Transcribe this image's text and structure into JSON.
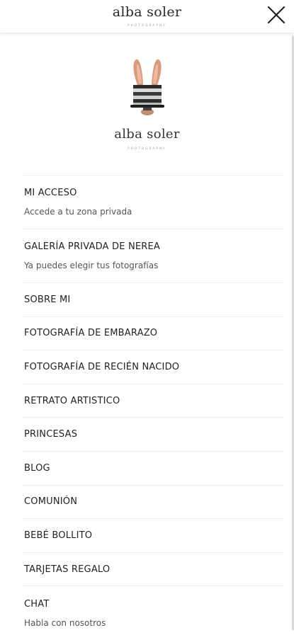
{
  "header": {
    "brand_name": "alba soler",
    "brand_tagline": "PHOTOGRAPHY",
    "close_icon": "close-icon"
  },
  "logo": {
    "brand_name": "alba soler",
    "brand_tagline": "PHOTOGRAPHY",
    "illustration": "bunny-ears-hat-illustration"
  },
  "menu": {
    "items": [
      {
        "label": "MI ACCESO",
        "sub": "Accede a tu zona privada"
      },
      {
        "label": "GALERÍA PRIVADA DE NEREA",
        "sub": "Ya puedes elegir tus fotografías"
      },
      {
        "label": "SOBRE MI"
      },
      {
        "label": "FOTOGRAFÍA DE EMBARAZO"
      },
      {
        "label": "FOTOGRAFÍA DE RECIÉN NACIDO"
      },
      {
        "label": "RETRATO ARTISTICO"
      },
      {
        "label": "PRINCESAS"
      },
      {
        "label": "BLOG"
      },
      {
        "label": "COMUNIÓN"
      },
      {
        "label": "BEBÉ BOLLITO"
      },
      {
        "label": "TARJETAS REGALO"
      },
      {
        "label": "CHAT",
        "sub": "Habla con nosotros"
      }
    ]
  },
  "colors": {
    "text": "#222222",
    "subtext": "#555555",
    "divider": "#eeeeee",
    "background": "#ffffff"
  }
}
